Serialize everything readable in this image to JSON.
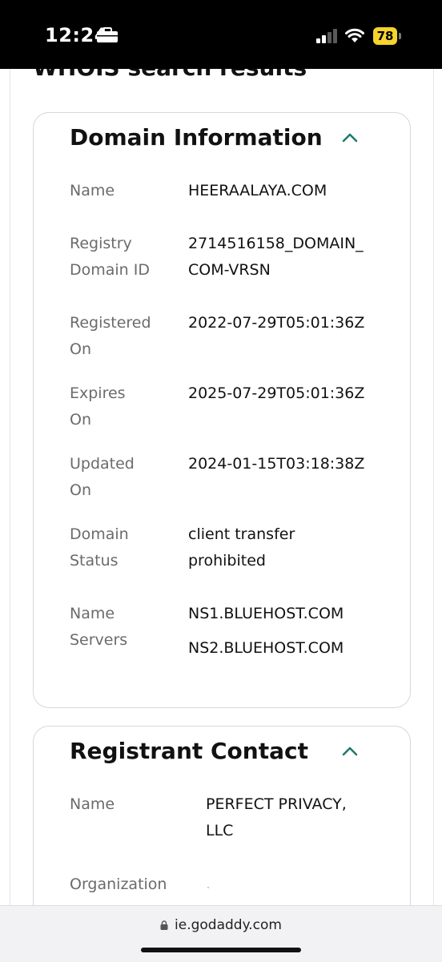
{
  "status_bar": {
    "time": "12:24",
    "battery": "78"
  },
  "page": {
    "partial_heading": "WHOIS search results"
  },
  "domain_info": {
    "title": "Domain Information",
    "rows": [
      {
        "label_lines": [
          "Name"
        ],
        "value_lines": [
          "HEERAALAYA.COM"
        ]
      },
      {
        "label_lines": [
          "Registry",
          "Domain ID"
        ],
        "value_lines": [
          "2714516158_DOMAIN_",
          "COM-VRSN"
        ]
      },
      {
        "label_lines": [
          "Registered",
          "On"
        ],
        "value_lines": [
          "2022-07-29T05:01:36Z"
        ]
      },
      {
        "label_lines": [
          "Expires",
          "On"
        ],
        "value_lines": [
          "2025-07-29T05:01:36Z"
        ]
      },
      {
        "label_lines": [
          "Updated",
          "On"
        ],
        "value_lines": [
          "2024-01-15T03:18:38Z"
        ]
      },
      {
        "label_lines": [
          "Domain",
          "Status"
        ],
        "value_lines": [
          "client transfer",
          "prohibited"
        ]
      },
      {
        "label_lines": [
          "Name",
          "Servers"
        ],
        "value_lines": [
          "NS1.BLUEHOST.COM",
          "NS2.BLUEHOST.COM"
        ]
      }
    ]
  },
  "registrant": {
    "title": "Registrant Contact",
    "rows": [
      {
        "label_lines": [
          "Name"
        ],
        "value_lines": [
          "PERFECT PRIVACY,",
          "LLC"
        ]
      },
      {
        "label_lines": [
          "Organization"
        ],
        "value_lines": []
      }
    ]
  },
  "url_bar": {
    "url": "ie.godaddy.com"
  },
  "icons": {
    "briefcase": "briefcase-icon",
    "signal": "cellular-signal-icon",
    "wifi": "wifi-icon",
    "battery": "battery-icon",
    "chevron": "chevron-up-icon",
    "lock": "lock-icon"
  },
  "colors": {
    "accent": "#1a7a6d",
    "label": "#6b6b6b",
    "battery": "#f6d32d"
  }
}
